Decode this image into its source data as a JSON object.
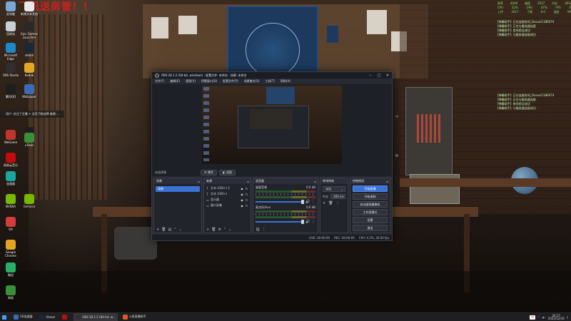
{
  "banner": {
    "text": "飞机送房管！！"
  },
  "desktop_icons": [
    {
      "label": "此电脑",
      "color": "#7aa7d8"
    },
    {
      "label": "新建文本文档",
      "color": "#e9e9e9"
    },
    {
      "label": "回收站",
      "color": "#c9cfd6"
    },
    {
      "label": "Epic Games Launcher",
      "color": "#2a2a2a"
    },
    {
      "label": "Microsoft Edge",
      "color": "#1e88c9"
    },
    {
      "label": "steam",
      "color": "#1b2838"
    },
    {
      "label": "OBS Studio",
      "color": "#302e31"
    },
    {
      "label": "Kodak",
      "color": "#e3a623"
    },
    {
      "label": "腾讯QQ",
      "color": "#1e1e1e"
    },
    {
      "label": "Wallpaper",
      "color": "#3b6bb8"
    },
    {
      "label": "小黑盒",
      "color": "#1e1e1e"
    },
    {
      "label": "WeGame",
      "color": "#c0362c"
    },
    {
      "label": "uTools",
      "color": "#3a8f3a"
    },
    {
      "label": "网易云音乐",
      "color": "#c20c0c"
    },
    {
      "label": "加速器",
      "color": "#1aa7a1"
    },
    {
      "label": "NVIDIA",
      "color": "#76b900"
    },
    {
      "label": "GeForce",
      "color": "#76b900"
    },
    {
      "label": "OA",
      "color": "#d23c3c"
    },
    {
      "label": "Google Chrome",
      "color": "#e4a522"
    },
    {
      "label": "微信",
      "color": "#2aae67"
    },
    {
      "label": "网易",
      "color": "#3a8f3a"
    }
  ],
  "left_overlay": {
    "text": "用户: 关注了主播 + 点亮了粉丝牌 感谢 ..."
  },
  "stats": {
    "rows": [
      [
        "帧率",
        "4048",
        "磁盘",
        "2917",
        "内存",
        "36%"
      ],
      [
        "CPU",
        "32%",
        "GPU",
        "47%",
        "FPS",
        "0"
      ],
      [
        "上传",
        "2017",
        "下载",
        "0.0",
        "温度",
        "99"
      ]
    ]
  },
  "chat_top": {
    "lines": [
      "[弹幕助手]: 正在连接房间_Dnsxx/1186074",
      "[弹幕助手]: 正在与服务器连接",
      "[弹幕助手]: 房间验证成功",
      "[弹幕助手]: 与服务器连接成功"
    ]
  },
  "chat_mid": {
    "lines": [
      "[弹幕助手]: 正在连接房间_Dnsxx/1186074",
      "[弹幕助手]: 正在与服务器连接",
      "[弹幕助手]: 房间验证成功",
      "[弹幕助手]: 与服务器连接成功"
    ]
  },
  "obs": {
    "title": "OBS 28.1.2 (64-bit, windows) - 配置文件: 未命名 - 场景: 未命名",
    "menu": [
      "文件(F)",
      "编辑(E)",
      "视图(V)",
      "停靠窗口(D)",
      "配置文件(P)",
      "场景集合(S)",
      "工具(T)",
      "帮助(H)"
    ],
    "source_toolbar": {
      "name": "未选择源",
      "props": "属性",
      "filters": "滤镜"
    },
    "scenes": {
      "title": "场景",
      "items": [
        "场景"
      ]
    },
    "sources": {
      "title": "来源",
      "items": [
        {
          "label": "文本 (GDI+) 2",
          "icon": "T"
        },
        {
          "label": "文本 (GDI+)",
          "icon": "T"
        },
        {
          "label": "显示器",
          "icon": "▭"
        },
        {
          "label": "窗口采集",
          "icon": "▭"
        }
      ]
    },
    "mixer": {
      "title": "混音器",
      "channels": [
        {
          "name": "桌面音频",
          "db": "0.0 dB"
        },
        {
          "name": "麦克风/Aux",
          "db": "0.0 dB"
        }
      ]
    },
    "transitions": {
      "title": "转场特效",
      "type": "淡出",
      "duration_label": "时长",
      "duration": "300 ms"
    },
    "controls": {
      "title": "控制按钮",
      "buttons": [
        "开始直播",
        "开始录制",
        "启动虚拟摄像机",
        "工作室模式",
        "设置",
        "退出"
      ]
    },
    "status": {
      "live": "LIVE: 00:00:00",
      "rec": "REC: 00:00:00",
      "cpu": "CPU: 0.2%, 30.00 fps"
    }
  },
  "taskbar": {
    "apps": [
      {
        "label": "US加速器",
        "color": "#3b6bb8",
        "active": false
      },
      {
        "label": "Steam",
        "color": "#1b2838",
        "active": false
      },
      {
        "label": "",
        "color": "#c20c0c",
        "active": false
      },
      {
        "label": "OBS 28.1.2 (64-bit, w...",
        "color": "#302e31",
        "active": true
      },
      {
        "label": "斗鱼直播助手",
        "color": "#e05a1f",
        "active": false
      }
    ],
    "ime": "中",
    "time": "20:17",
    "date": "2022/12/16"
  }
}
